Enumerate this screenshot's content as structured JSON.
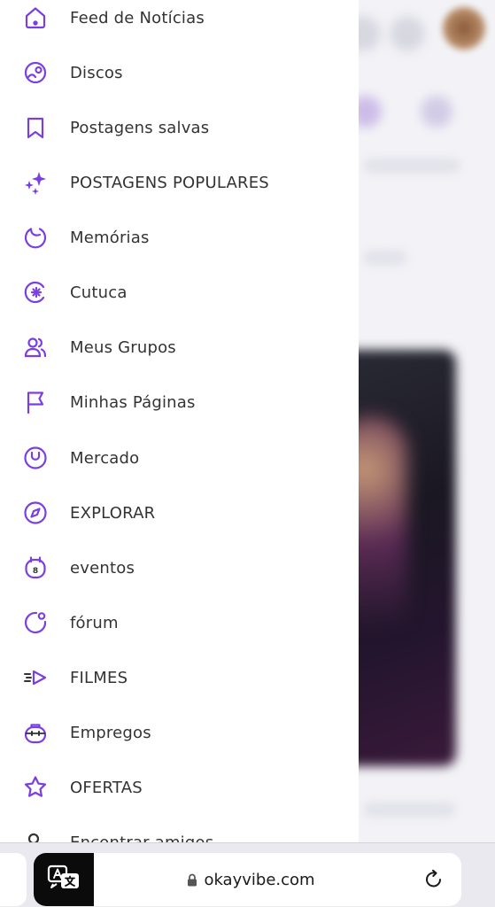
{
  "drawer": {
    "items": [
      {
        "label": "Feed de Notícias",
        "icon": "home-icon"
      },
      {
        "label": "Discos",
        "icon": "disc-icon"
      },
      {
        "label": "Postagens salvas",
        "icon": "bookmark-icon"
      },
      {
        "label": "POSTAGENS POPULARES",
        "icon": "sparkles-icon"
      },
      {
        "label": "Memórias",
        "icon": "memories-icon"
      },
      {
        "label": "Cutuca",
        "icon": "poke-icon"
      },
      {
        "label": "Meus Grupos",
        "icon": "groups-icon"
      },
      {
        "label": "Minhas Páginas",
        "icon": "flag-icon"
      },
      {
        "label": "Mercado",
        "icon": "market-bag-icon"
      },
      {
        "label": "EXPLORAR",
        "icon": "compass-icon"
      },
      {
        "label": "eventos",
        "icon": "calendar-icon"
      },
      {
        "label": "fórum",
        "icon": "forum-icon"
      },
      {
        "label": "FILMES",
        "icon": "movies-icon"
      },
      {
        "label": "Empregos",
        "icon": "briefcase-icon"
      },
      {
        "label": "OFERTAS",
        "icon": "offers-star-icon"
      },
      {
        "label": "Encontrar amigos",
        "icon": "find-friends-icon"
      }
    ]
  },
  "browser": {
    "url": "okayvibe.com"
  },
  "colors": {
    "accent": "#7a3fe0",
    "text": "#333333",
    "drawer_bg": "#ffffff",
    "bar_bg": "#e9e9ef"
  }
}
